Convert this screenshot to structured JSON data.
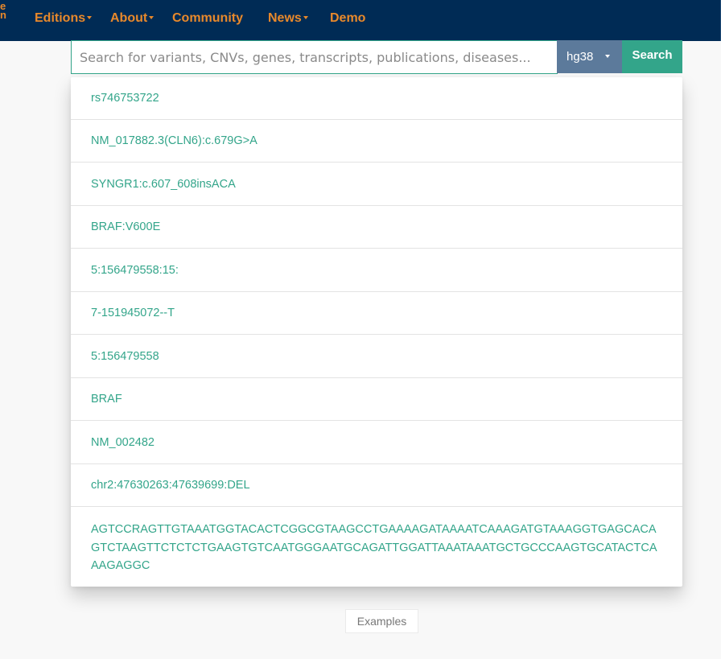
{
  "nav": {
    "logo_fragment": [
      "e",
      "n"
    ],
    "items": [
      {
        "label": "Editions",
        "has_dropdown": true
      },
      {
        "label": "About",
        "has_dropdown": true
      },
      {
        "label": "Community",
        "has_dropdown": false
      },
      {
        "label": "News",
        "has_dropdown": true
      },
      {
        "label": "Demo",
        "has_dropdown": false
      }
    ]
  },
  "search": {
    "value": "",
    "placeholder": "Search for variants, CNVs, genes, transcripts, publications, diseases...",
    "genome": "hg38",
    "button_label": "Search"
  },
  "suggestions": [
    "rs746753722",
    "NM_017882.3(CLN6):c.679G>A",
    "SYNGR1:c.607_608insACA",
    "BRAF:V600E",
    "5:156479558:15:",
    "7-151945072--T",
    "5:156479558",
    "BRAF",
    "NM_002482",
    "chr2:47630263:47639699:DEL",
    "AGTCCRAGTTGTAAATGGTACACTCGGCGTAAGCCTGAAAAGATAAAATCAAAGATGTAAAGGTGAGCACAGTCTAAGTTCTCTCTGAAGTGTCAATGGGAATGCAGATTGGATTAAATAAATGCTGCCCAAGTGCATACTCAAAGAGGC"
  ],
  "examples_label": "Examples",
  "colors": {
    "topbar": "#002b55",
    "nav_text": "#e8892b",
    "accent": "#33a58a",
    "genome_select": "#5c7a9b",
    "page_bg": "#f8f8f8"
  }
}
